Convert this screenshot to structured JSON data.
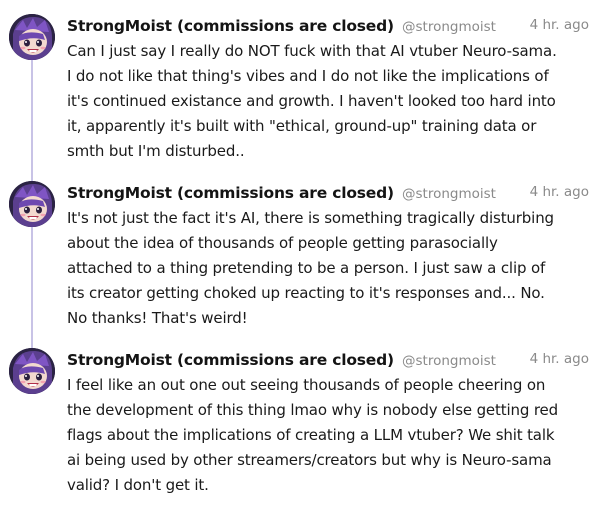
{
  "posts": [
    {
      "author": "StrongMoist (commissions are closed)",
      "handle": "@strongmoist",
      "time": "4 hr. ago",
      "avatar_icon": "anime-avatar-icon",
      "text": "Can I just say I really do NOT fuck with that AI vtuber Neuro-sama.\nI do not like that thing's vibes and I do not like the implications of\nit's continued existance and growth. I haven't looked too hard into\nit, apparently it's built with \"ethical, ground-up\" training data or\nsmth but I'm disturbed.."
    },
    {
      "author": "StrongMoist (commissions are closed)",
      "handle": "@strongmoist",
      "time": "4 hr. ago",
      "avatar_icon": "anime-avatar-icon",
      "text": "It's not just the fact it's AI, there is something tragically disturbing\nabout the idea of thousands of people getting parasocially\nattached to a thing pretending to be a person. I just saw a clip of\nits creator getting choked up reacting to it's responses and... No.\nNo thanks! That's weird!"
    },
    {
      "author": "StrongMoist (commissions are closed)",
      "handle": "@strongmoist",
      "time": "4 hr. ago",
      "avatar_icon": "anime-avatar-icon",
      "text": "I feel like an out one out seeing thousands of people cheering on\nthe development of this thing lmao why is nobody else getting red\nflags about the implications of creating a LLM vtuber? We shit talk\nai being used by other streamers/creators but why is Neuro-sama\nvalid? I don't get it."
    }
  ],
  "colors": {
    "thread_line": "#c8c3e6",
    "name": "#141414",
    "meta": "#8a8a8a",
    "body": "#1a1a1a"
  }
}
